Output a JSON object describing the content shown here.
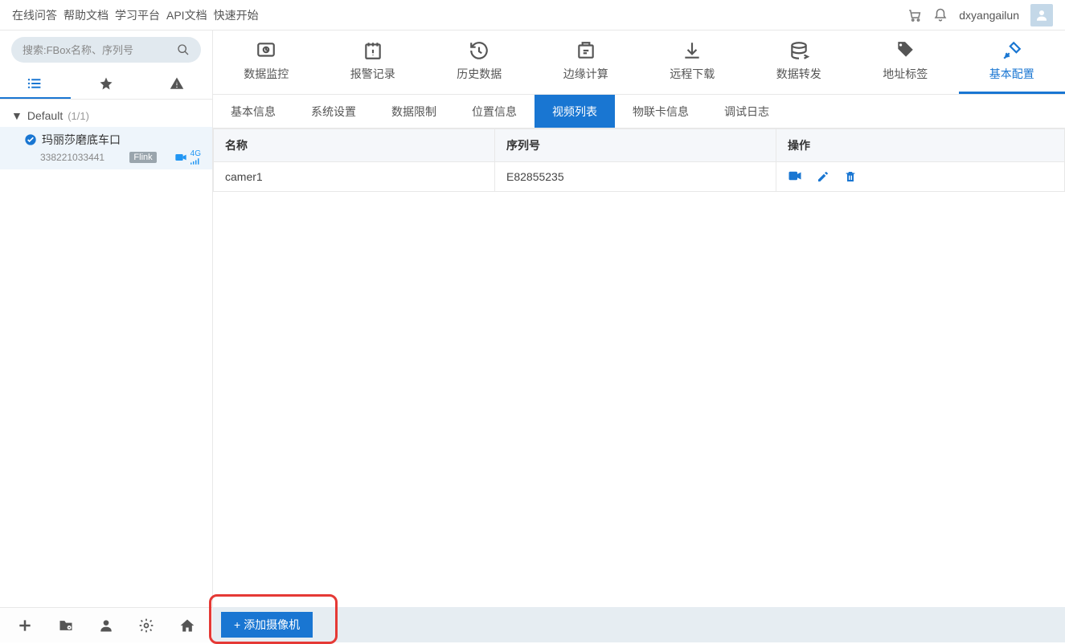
{
  "topNav": {
    "links": [
      "在线问答",
      "帮助文档",
      "学习平台",
      "API文档",
      "快速开始"
    ],
    "username": "dxyangailun"
  },
  "sidebar": {
    "searchPlaceholder": "搜索:FBox名称、序列号",
    "group": {
      "name": "Default",
      "count": "(1/1)"
    },
    "device": {
      "name": "玛丽莎磨底车口",
      "serial": "338221033441",
      "badge": "Flink",
      "signal": "4G"
    }
  },
  "iconTabs": [
    "数据监控",
    "报警记录",
    "历史数据",
    "边缘计算",
    "远程下载",
    "数据转发",
    "地址标签",
    "基本配置"
  ],
  "iconTabActive": 7,
  "subTabs": [
    "基本信息",
    "系统设置",
    "数据限制",
    "位置信息",
    "视频列表",
    "物联卡信息",
    "调试日志"
  ],
  "subTabActive": 4,
  "table": {
    "headers": [
      "名称",
      "序列号",
      "操作"
    ],
    "rows": [
      {
        "name": "camer1",
        "serial": "E82855235"
      }
    ]
  },
  "addButton": "添加摄像机"
}
